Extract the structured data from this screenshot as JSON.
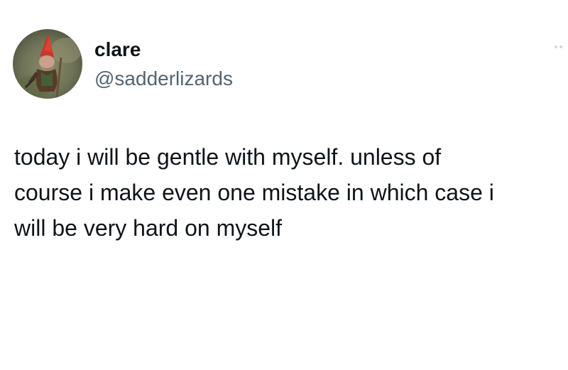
{
  "author": {
    "display_name": "clare",
    "handle": "@sadderlizards",
    "avatar_icon": "gnome-figure-photo-avatar"
  },
  "tweet": {
    "lines": [
      "today i will be gentle with myself. unless of",
      "course i make even one mistake in which case i",
      "will be very hard on myself"
    ]
  },
  "header": {
    "more_icon": "more-options-icon"
  },
  "colors": {
    "text_primary": "#0f1419",
    "text_secondary": "#536471",
    "background": "#ffffff"
  }
}
